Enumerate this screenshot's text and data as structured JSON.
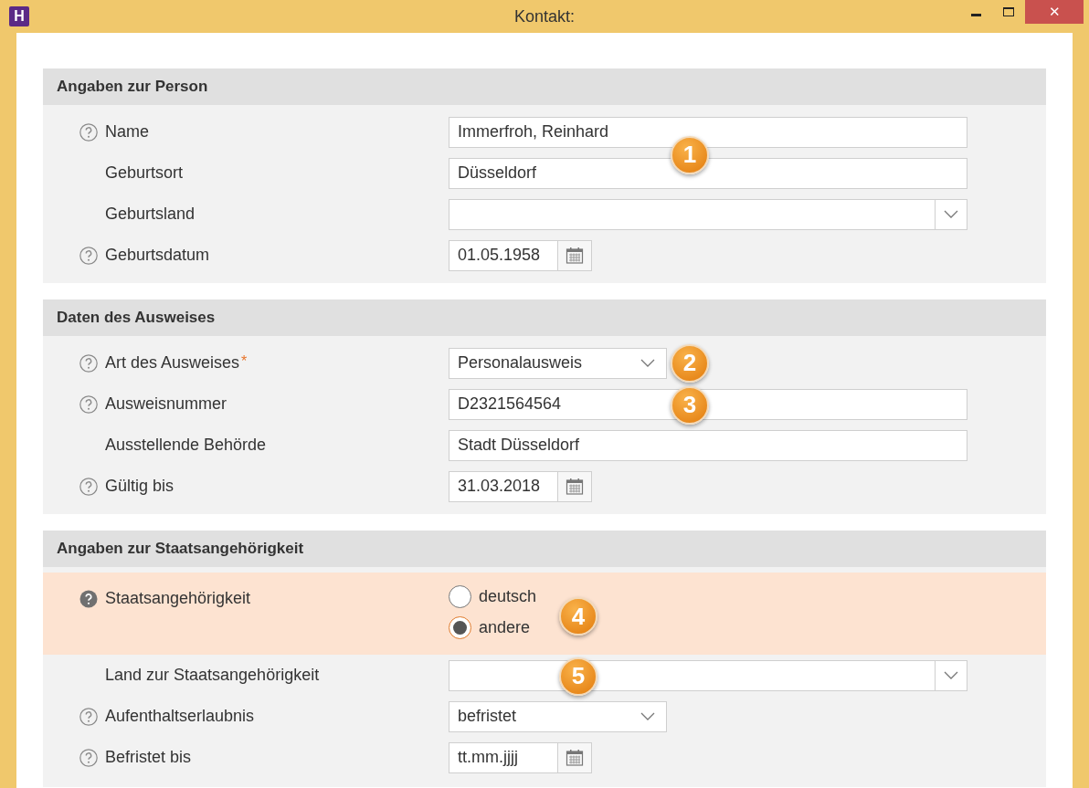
{
  "window": {
    "app_icon": "H",
    "title": "Kontakt:",
    "close": "✕"
  },
  "sections": [
    {
      "title": "Angaben zur Person",
      "rows": [
        {
          "kind": "text",
          "label": "Name",
          "help": true,
          "value": "Immerfroh, Reinhard",
          "callout": "1"
        },
        {
          "kind": "text",
          "label": "Geburtsort",
          "help": false,
          "value": "Düsseldorf"
        },
        {
          "kind": "select",
          "label": "Geburtsland",
          "help": false
        },
        {
          "kind": "date",
          "label": "Geburtsdatum",
          "help": true,
          "value": "01.05.1958"
        }
      ]
    },
    {
      "title": "Daten des Ausweises",
      "rows": [
        {
          "kind": "dropdown",
          "label": "Art des Ausweises",
          "required_mark": "*",
          "help": true,
          "value": "Personalausweis",
          "callout": "2"
        },
        {
          "kind": "text",
          "label": "Ausweisnummer",
          "help": true,
          "value": "D2321564564",
          "callout": "3"
        },
        {
          "kind": "text",
          "label": "Ausstellende Behörde",
          "help": false,
          "value": "Stadt Düsseldorf"
        },
        {
          "kind": "date",
          "label": "Gültig bis",
          "help": true,
          "value": "31.03.2018"
        }
      ]
    },
    {
      "title": "Angaben zur Staatsangehörigkeit",
      "rows": [
        {
          "kind": "radio",
          "label": "Staatsangehörigkeit",
          "help": true,
          "highlighted": true,
          "callout": "4",
          "options": [
            {
              "label": "deutsch",
              "selected": false
            },
            {
              "label": "andere",
              "selected": true
            }
          ]
        },
        {
          "kind": "select",
          "label": "Land zur Staatsangehörigkeit",
          "help": false,
          "callout": "5"
        },
        {
          "kind": "dropdown",
          "label": "Aufenthaltserlaubnis",
          "help": true,
          "value": "befristet"
        },
        {
          "kind": "date",
          "label": "Befristet bis",
          "help": true,
          "placeholder": "tt.mm.jjjj"
        }
      ]
    }
  ]
}
